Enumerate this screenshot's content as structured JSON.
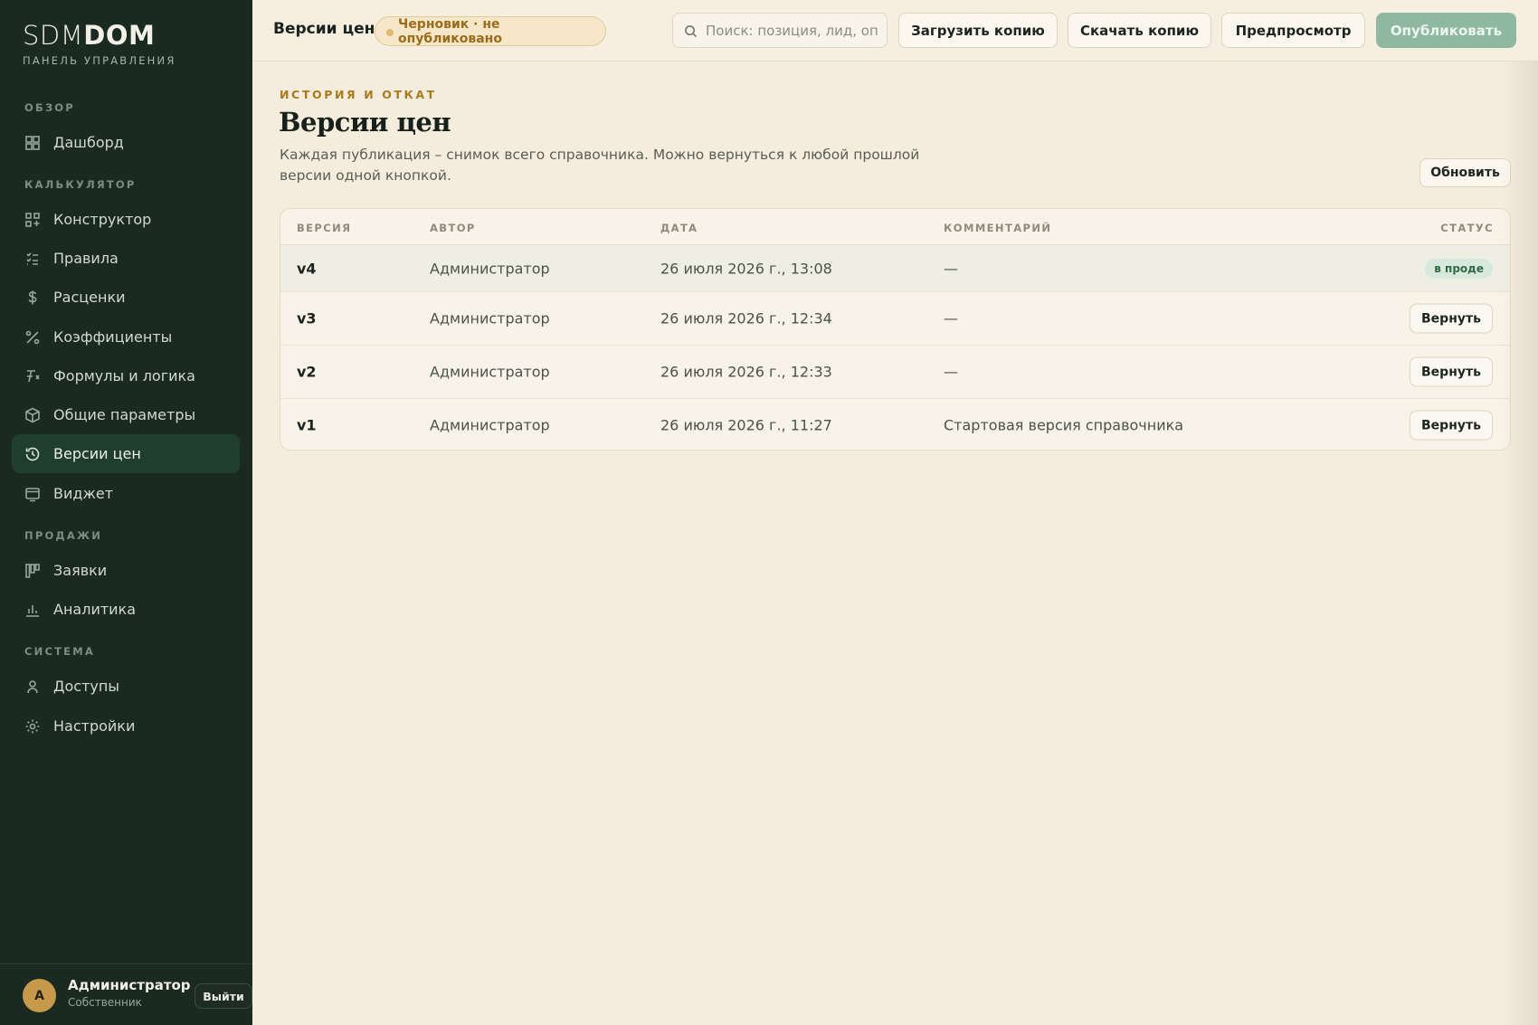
{
  "brand": {
    "logo_light": "SDM",
    "logo_bold": "DOM",
    "subtitle": "ПАНЕЛЬ УПРАВЛЕНИЯ"
  },
  "sidebar": {
    "sections": {
      "overview": "ОБЗОР",
      "calculator": "КАЛЬКУЛЯТОР",
      "sales": "ПРОДАЖИ",
      "system": "СИСТЕМА"
    },
    "items": [
      {
        "label": "Дашборд",
        "icon": "dashboard-icon"
      },
      {
        "label": "Конструктор",
        "icon": "constructor-icon"
      },
      {
        "label": "Правила",
        "icon": "rules-icon"
      },
      {
        "label": "Расценки",
        "icon": "dollar-icon"
      },
      {
        "label": "Коэффициенты",
        "icon": "percent-icon"
      },
      {
        "label": "Формулы и логика",
        "icon": "formula-icon"
      },
      {
        "label": "Общие параметры",
        "icon": "box-icon"
      },
      {
        "label": "Версии цен",
        "icon": "history-icon",
        "active": true
      },
      {
        "label": "Виджет",
        "icon": "widget-icon"
      },
      {
        "label": "Заявки",
        "icon": "kanban-icon"
      },
      {
        "label": "Аналитика",
        "icon": "chart-icon"
      },
      {
        "label": "Доступы",
        "icon": "user-icon"
      },
      {
        "label": "Настройки",
        "icon": "gear-icon"
      }
    ],
    "user": {
      "initial": "А",
      "name": "Администратор",
      "role": "Собственник",
      "logout": "Выйти"
    }
  },
  "topbar": {
    "title": "Версии цен",
    "draft_badge": "Черновик · не опубликовано",
    "search_placeholder": "Поиск: позиция, лид, опция",
    "upload": "Загрузить копию",
    "download": "Скачать копию",
    "preview": "Предпросмотр",
    "publish": "Опубликовать"
  },
  "page": {
    "eyebrow": "ИСТОРИЯ И ОТКАТ",
    "title": "Версии цен",
    "description": "Каждая публикация – снимок всего справочника. Можно вернуться к любой прошлой версии одной кнопкой.",
    "refresh": "Обновить"
  },
  "table": {
    "headers": {
      "version": "ВЕРСИЯ",
      "author": "АВТОР",
      "date": "ДАТА",
      "comment": "КОММЕНТАРИЙ",
      "status": "СТАТУС"
    },
    "rows": [
      {
        "version": "v4",
        "author": "Администратор",
        "date": "26 июля 2026 г., 13:08",
        "comment": "—",
        "status": "в проде"
      },
      {
        "version": "v3",
        "author": "Администратор",
        "date": "26 июля 2026 г., 12:34",
        "comment": "—",
        "action": "Вернуть"
      },
      {
        "version": "v2",
        "author": "Администратор",
        "date": "26 июля 2026 г., 12:33",
        "comment": "—",
        "action": "Вернуть"
      },
      {
        "version": "v1",
        "author": "Администратор",
        "date": "26 июля 2026 г., 11:27",
        "comment": "Стартовая версия справочника",
        "action": "Вернуть"
      }
    ]
  },
  "colors": {
    "sidebar": "#1a2a20",
    "accent_green": "#8eb9a0",
    "gold": "#a97a1f",
    "background": "#f4ecdc"
  }
}
